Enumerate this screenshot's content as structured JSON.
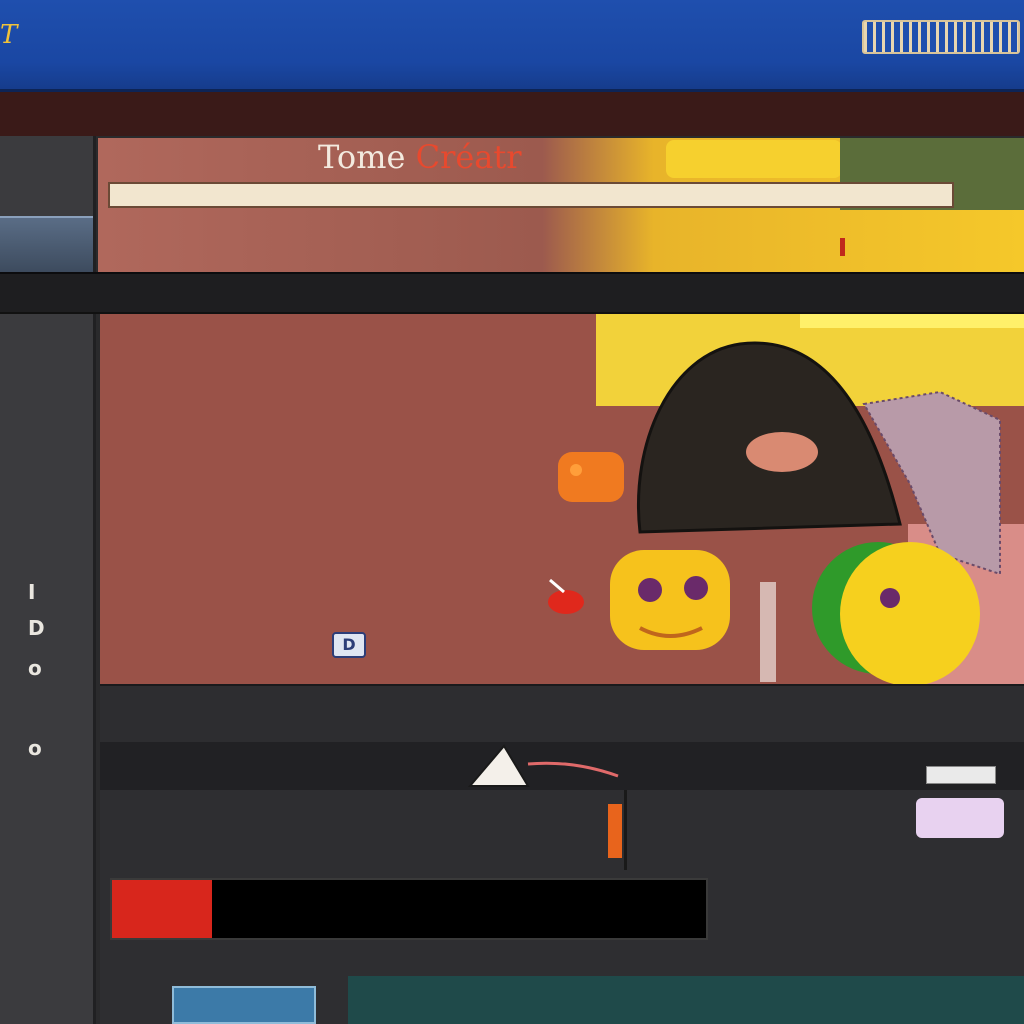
{
  "window": {
    "title": "T",
    "status_indicator": ""
  },
  "hero": {
    "title_main": "Tome",
    "title_accent": "Créatr",
    "subtitle": "",
    "footer": ""
  },
  "left_nav": {
    "items": [
      "",
      "",
      "",
      ""
    ],
    "vertical_labels": [
      "I",
      "D",
      "o",
      "o"
    ]
  },
  "breadcrumb": "",
  "feature": {
    "heading": "",
    "lines": [
      "",
      "",
      "",
      "",
      ""
    ],
    "small_button": "D"
  },
  "panel_a": {
    "label": ""
  },
  "panel_b": {
    "left": "",
    "right": ""
  },
  "panel_c": {
    "left_col": [
      "",
      ""
    ],
    "mid_col": [
      "",
      ""
    ],
    "right_col": [
      "",
      ""
    ],
    "badge": "",
    "note": [
      "",
      ""
    ]
  },
  "action": {
    "button": "",
    "field": ""
  },
  "footer_thumb": "",
  "colors": {
    "titlebar": "#1f4fae",
    "accent_red": "#d8261c",
    "accent_yellow": "#f5c82a",
    "feature_bg": "#9a5248"
  }
}
